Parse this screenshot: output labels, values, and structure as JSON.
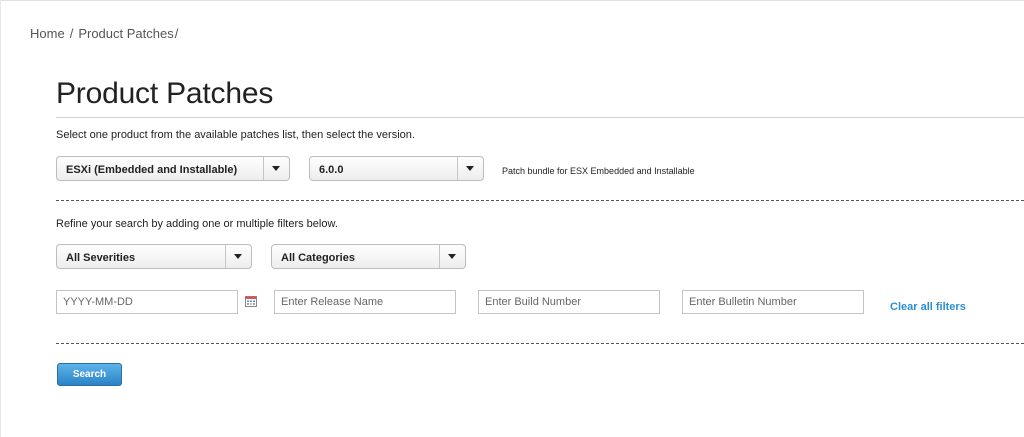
{
  "breadcrumb": {
    "home": "Home",
    "sep1": "/",
    "current": "Product Patches",
    "sep2": "/"
  },
  "page": {
    "title": "Product Patches"
  },
  "instructions": {
    "select_product": "Select one product from the available patches list, then select the version.",
    "refine": "Refine your search by adding one or multiple filters below."
  },
  "product_select": {
    "value": "ESXi (Embedded and Installable)"
  },
  "version_select": {
    "value": "6.0.0"
  },
  "patch_hint": "Patch bundle for ESX Embedded and Installable",
  "severity_select": {
    "value": "All Severities"
  },
  "category_select": {
    "value": "All Categories"
  },
  "filters": {
    "date_placeholder": "YYYY-MM-DD",
    "release_placeholder": "Enter Release Name",
    "build_placeholder": "Enter Build Number",
    "bulletin_placeholder": "Enter Bulletin Number",
    "calendar_icon": "calendar-icon",
    "clear_label": "Clear all filters"
  },
  "search_button": {
    "label": "Search"
  },
  "colors": {
    "link": "#2b8ed0",
    "button": "#2b83c5"
  }
}
